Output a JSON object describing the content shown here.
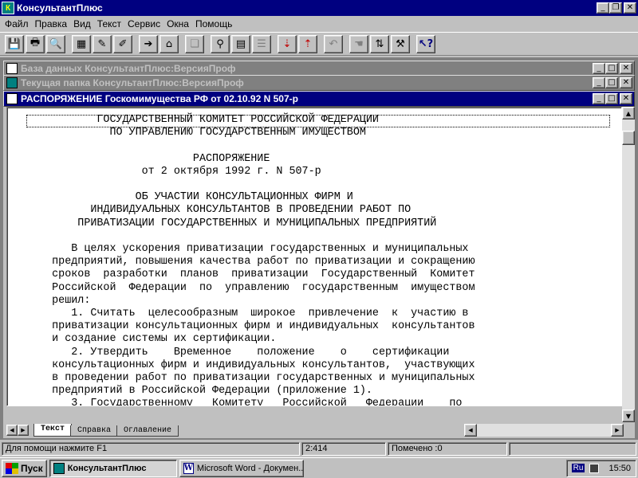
{
  "app": {
    "title": "КонсультантПлюс",
    "icon_name": "consultant-app-icon"
  },
  "menu": [
    "Файл",
    "Правка",
    "Вид",
    "Текст",
    "Сервис",
    "Окна",
    "Помощь"
  ],
  "toolbar": {
    "groups": [
      [
        "save-icon",
        "print-icon",
        "preview-icon"
      ],
      [
        "search-card-icon",
        "edit-card-icon",
        "query-icon"
      ],
      [
        "folder-in-icon",
        "folder-home-icon"
      ],
      [
        "copy-icon"
      ],
      [
        "binoculars-icon",
        "bookmark-icon",
        "list-icon"
      ],
      [
        "export-red-icon",
        "import-red-icon"
      ],
      [
        "undo-icon"
      ],
      [
        "hand-icon",
        "sort-icon",
        "tools-icon"
      ],
      [
        "help-pointer-icon"
      ]
    ]
  },
  "windows": {
    "db": "База данных КонсультантПлюс:ВерсияПроф",
    "folder": "Текущая папка КонсультантПлюс:ВерсияПроф",
    "doc": "РАСПОРЯЖЕНИЕ Госкомимущества РФ от 02.10.92 N 507-р"
  },
  "document": {
    "text": "           ГОСУДАРСТВЕННЫЙ КОМИТЕТ РОССИЙСКОЙ ФЕДЕРАЦИИ\n             ПО УПРАВЛЕНИЮ ГОСУДАРСТВЕННЫМ ИМУЩЕСТВОМ\n\n                          РАСПОРЯЖЕНИЕ\n                  от 2 октября 1992 г. N 507-р\n\n                 ОБ УЧАСТИИ КОНСУЛЬТАЦИОННЫХ ФИРМ И\n          ИНДИВИДУАЛЬНЫХ КОНСУЛЬТАНТОВ В ПРОВЕДЕНИИ РАБОТ ПО\n        ПРИВАТИЗАЦИИ ГОСУДАРСТВЕННЫХ И МУНИЦИПАЛЬНЫХ ПРЕДПРИЯТИЙ\n\n       В целях ускорения приватизации государственных и муниципальных\n    предприятий, повышения качества работ по приватизации и сокращению\n    сроков  разработки  планов  приватизации  Государственный  Комитет\n    Российской  Федерации  по  управлению  государственным  имуществом\n    решил:\n       1. Считать  целесообразным  широкое  привлечение  к  участию в\n    приватизации консультационных фирм и индивидуальных  консультантов\n    и создание системы их сертификации.\n       2. Утвердить    Временное    положение    о    сертификации\n    консультационных фирм и индивидуальных консультантов,  участвующих\n    в проведении работ по приватизации государственных и муниципальных\n    предприятий в Российской Федерации (приложение 1).\n       3. Государственному   Комитету   Российской   Федерации    по\n    управлению  государственным  имуществом,  комитетам  по управлению"
  },
  "tabs": [
    "Текст",
    "Справка",
    "Оглавление"
  ],
  "status": {
    "help": "Для помощи нажмите F1",
    "line": "2:414",
    "marked": "Помечено :0"
  },
  "taskbar": {
    "start": "Пуск",
    "tasks": [
      "КонсультантПлюс",
      "Microsoft Word - Докумен..."
    ],
    "lang": "Ru",
    "clock": "15:50"
  }
}
